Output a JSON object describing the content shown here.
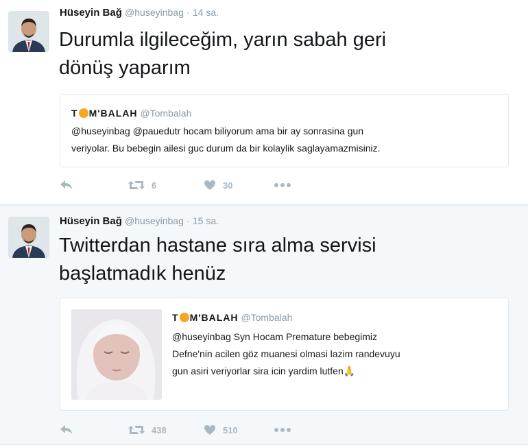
{
  "tweets": [
    {
      "author_name": "Hüseyin Bağ",
      "author_handle": "@huseyinbag",
      "separator": "·",
      "time": "14 sa.",
      "text_line1": "Durumla ilgileceğim, yarın sabah geri",
      "text_line2": "dönüş yaparım",
      "quote": {
        "name_prefix": "T",
        "name_suffix": "M'BALAH",
        "handle": "@Tombalah",
        "text_line1": "@huseyinbag @pauedutr hocam biliyorum ama bir ay sonrasina gun",
        "text_line2": "veriyolar. Bu bebegin ailesi guc durum da bir kolaylik saglayamazmisiniz."
      },
      "retweet_count": "6",
      "like_count": "30"
    },
    {
      "author_name": "Hüseyin Bağ",
      "author_handle": "@huseyinbag",
      "separator": "·",
      "time": "15 sa.",
      "text_line1": "Twitterdan hastane sıra alma servisi",
      "text_line2": "başlatmadık henüz",
      "quote": {
        "name_prefix": "T",
        "name_suffix": "M'BALAH",
        "handle": "@Tombalah",
        "text_line1": "@huseyinbag Syn Hocam Premature bebegimiz",
        "text_line2": "Defne'nin acilen göz muanesi olmasi lazim randevuyu",
        "text_line3": "gun asiri veriyorlar sira icin yardim lutfen",
        "emoji": "🙏"
      },
      "retweet_count": "438",
      "like_count": "510"
    }
  ],
  "icons": [
    "reply-icon",
    "retweet-icon",
    "heart-icon",
    "more-icon",
    "emoji-icon"
  ],
  "colors": {
    "action_gray": "#aab8c2",
    "handle_gray": "#8899a6",
    "quote_border": "#e1e8ed"
  }
}
